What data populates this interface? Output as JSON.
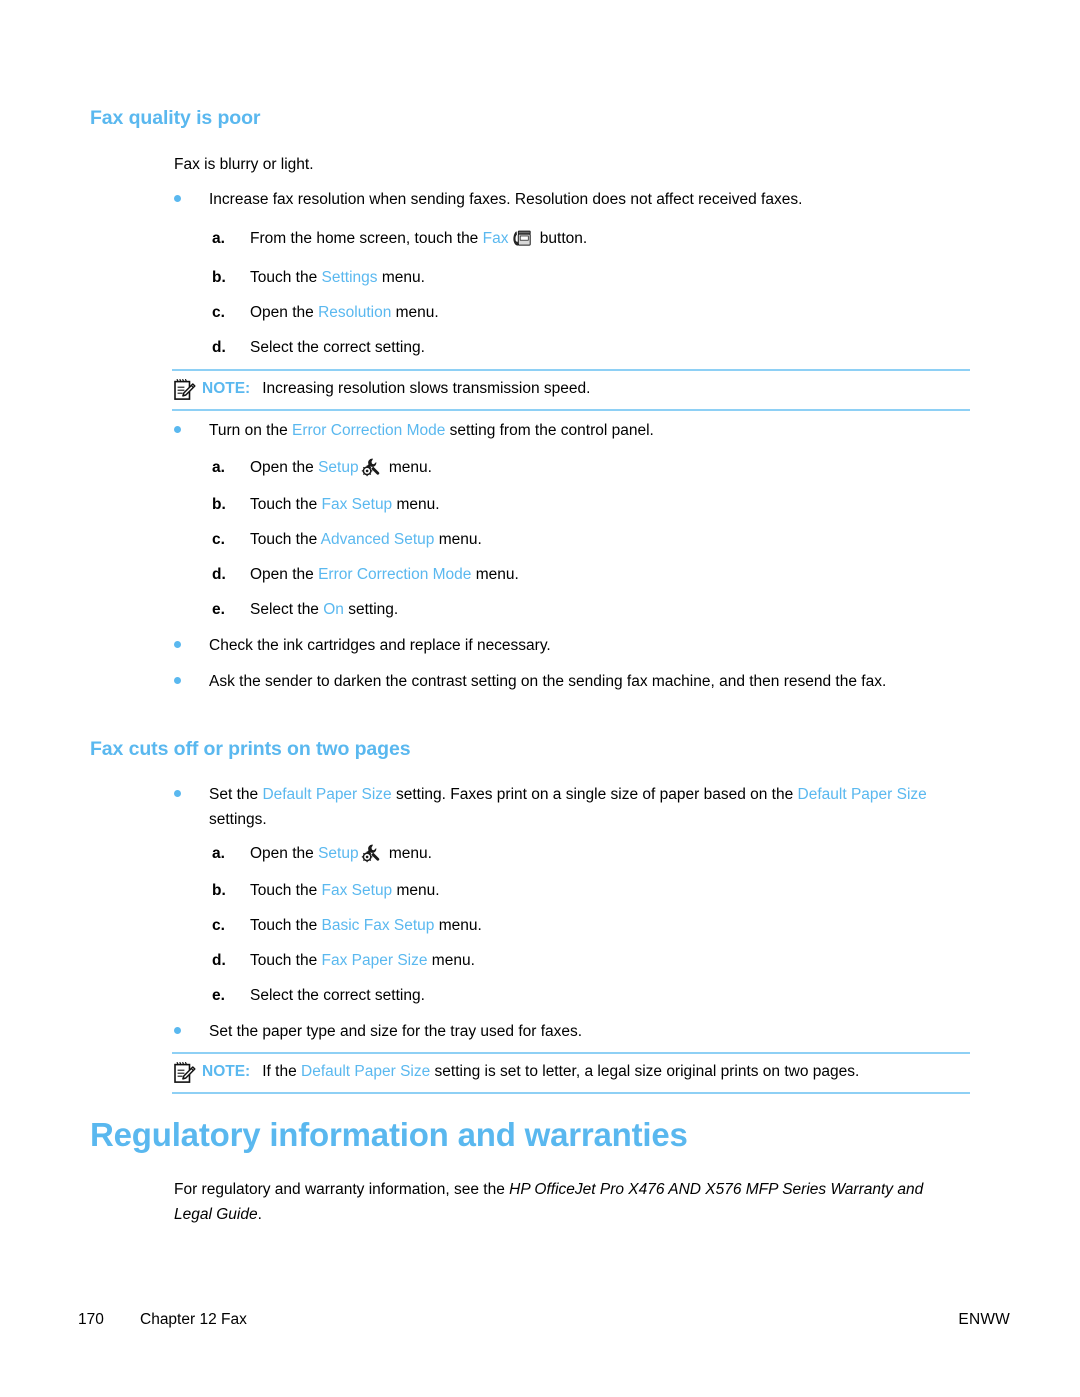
{
  "page": {
    "accent_blue": "#5AB8EF",
    "note_rule_color": "#8ED0F5",
    "text_color": "#000000"
  },
  "sections": {
    "fax_quality": {
      "heading": "Fax quality is poor",
      "intro": "Fax is blurry or light.",
      "bullet1": {
        "text_before": "Increase fax resolution when sending faxes. Resolution does not affect received faxes.",
        "steps": [
          {
            "mark": "a.",
            "pre": "From the home screen, touch the ",
            "link": "Fax",
            "icon": "fax-icon",
            "post": " button."
          },
          {
            "mark": "b.",
            "pre": "Touch the ",
            "link": "Settings",
            "post": " menu."
          },
          {
            "mark": "c.",
            "pre": "Open the ",
            "link": "Resolution",
            "post": " menu."
          },
          {
            "mark": "d.",
            "pre": "Select the correct setting.",
            "link": "",
            "post": ""
          }
        ]
      },
      "note1": {
        "label": "NOTE:",
        "text": "Increasing resolution slows transmission speed."
      },
      "bullet2": {
        "pre": "Turn on the ",
        "link": "Error Correction Mode",
        "post": " setting from the control panel.",
        "steps": [
          {
            "mark": "a.",
            "pre": "Open the ",
            "link": "Setup",
            "icon": "setup-wrench-icon",
            "post": " menu."
          },
          {
            "mark": "b.",
            "pre": "Touch the ",
            "link": "Fax Setup",
            "post": " menu."
          },
          {
            "mark": "c.",
            "pre": "Touch the ",
            "link": "Advanced Setup",
            "post": " menu."
          },
          {
            "mark": "d.",
            "pre": "Open the ",
            "link": "Error Correction Mode",
            "post": " menu."
          },
          {
            "mark": "e.",
            "pre": "Select the ",
            "link": "On",
            "post": " setting."
          }
        ]
      },
      "bullet3": "Check the ink cartridges and replace if necessary.",
      "bullet4": "Ask the sender to darken the contrast setting on the sending fax machine, and then resend the fax."
    },
    "fax_cuts_off": {
      "heading": "Fax cuts off or prints on two pages",
      "bullet1": {
        "pre": "Set the ",
        "link1": "Default Paper Size",
        "mid": " setting. Faxes print on a single size of paper based on the ",
        "link2": "Default Paper Size",
        "post": " settings.",
        "steps": [
          {
            "mark": "a.",
            "pre": "Open the ",
            "link": "Setup",
            "icon": "setup-wrench-icon",
            "post": " menu."
          },
          {
            "mark": "b.",
            "pre": "Touch the ",
            "link": "Fax Setup",
            "post": " menu."
          },
          {
            "mark": "c.",
            "pre": "Touch the ",
            "link": "Basic Fax Setup",
            "post": " menu."
          },
          {
            "mark": "d.",
            "pre": "Touch the ",
            "link": "Fax Paper Size",
            "post": " menu."
          },
          {
            "mark": "e.",
            "pre": "Select the correct setting.",
            "link": "",
            "post": ""
          }
        ]
      },
      "bullet2": "Set the paper type and size for the tray used for faxes.",
      "note1": {
        "label": "NOTE:",
        "pre": "If the ",
        "link": "Default Paper Size",
        "post": " setting is set to letter, a legal size original prints on two pages."
      }
    },
    "regulatory": {
      "heading": "Regulatory information and warranties",
      "body_pre": "For regulatory and warranty information, see the ",
      "body_italic": "HP OfficeJet Pro X476 AND X576 MFP Series Warranty and Legal Guide",
      "body_post": "."
    }
  },
  "footer": {
    "page_number": "170",
    "chapter": "Chapter 12   Fax",
    "locale": "ENWW"
  }
}
